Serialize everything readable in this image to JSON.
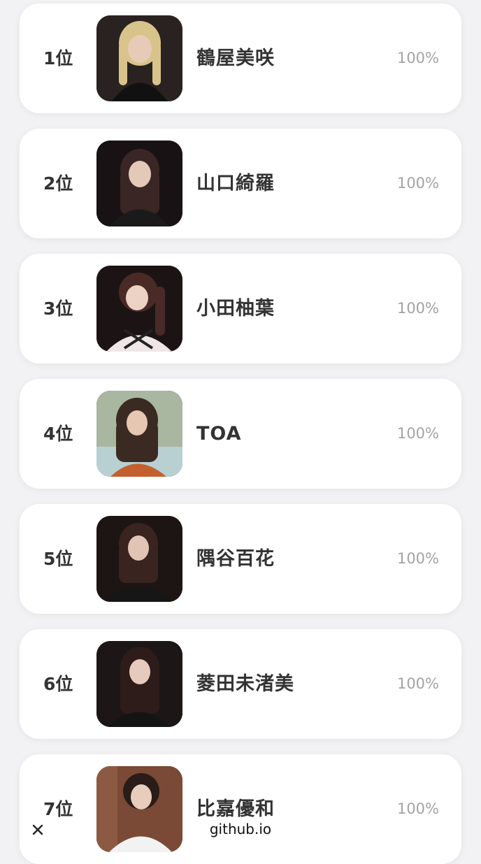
{
  "ranking": [
    {
      "rank": "1位",
      "name": "鶴屋美咲",
      "percent": "100%",
      "photo_tone": "#2a2220",
      "hair_tone": "#d8c48a",
      "cloth_tone": "#111111"
    },
    {
      "rank": "2位",
      "name": "山口綺羅",
      "percent": "100%",
      "photo_tone": "#181214",
      "hair_tone": "#3a2624",
      "cloth_tone": "#1a1a1a"
    },
    {
      "rank": "3位",
      "name": "小田柚葉",
      "percent": "100%",
      "photo_tone": "#1c1414",
      "hair_tone": "#4a2a26",
      "cloth_tone": "#efe6e8"
    },
    {
      "rank": "4位",
      "name": "TOA",
      "percent": "100%",
      "photo_tone": "#a9b6a0",
      "hair_tone": "#3b2a22",
      "cloth_tone": "#c4602e"
    },
    {
      "rank": "5位",
      "name": "隅谷百花",
      "percent": "100%",
      "photo_tone": "#1d1514",
      "hair_tone": "#3a2420",
      "cloth_tone": "#161616"
    },
    {
      "rank": "6位",
      "name": "菱田未渚美",
      "percent": "100%",
      "photo_tone": "#1c1616",
      "hair_tone": "#2e1c1a",
      "cloth_tone": "#141414"
    },
    {
      "rank": "7位",
      "name": "比嘉優和",
      "percent": "100%",
      "photo_tone": "#7a4a36",
      "hair_tone": "#2a1c18",
      "cloth_tone": "#f2f2f2"
    }
  ],
  "browser": {
    "url": "github.io",
    "close_icon": "close-icon"
  }
}
